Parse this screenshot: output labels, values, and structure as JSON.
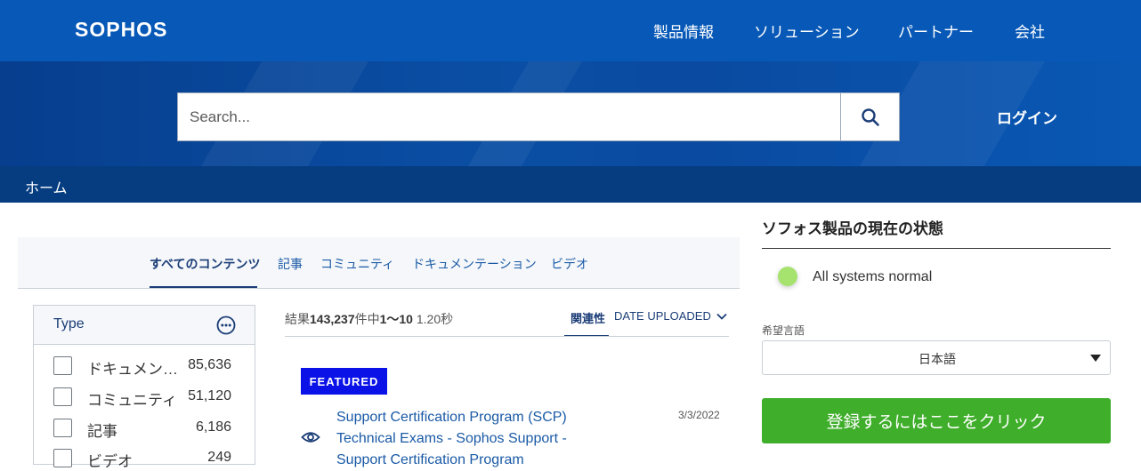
{
  "header": {
    "logo": "SOPHOS",
    "nav": [
      "製品情報",
      "ソリューション",
      "パートナー",
      "会社"
    ],
    "login": "ログイン"
  },
  "search": {
    "placeholder": "Search...",
    "value": ""
  },
  "breadcrumb": {
    "home": "ホーム"
  },
  "content_tabs": [
    "すべてのコンテンツ",
    "記事",
    "コミュニティ",
    "ドキュメンテーション",
    "ビデオ"
  ],
  "facet": {
    "title": "Type",
    "items": [
      {
        "label": "ドキュメンテーション",
        "count": "85,636"
      },
      {
        "label": "コミュニティ",
        "count": "51,120"
      },
      {
        "label": "記事",
        "count": "6,186"
      },
      {
        "label": "ビデオ",
        "count": "249"
      }
    ]
  },
  "results": {
    "prefix": "結果",
    "total": "143,237",
    "mid": "件中",
    "range": "1～10",
    "time": "1.20秒",
    "sort_relevance": "関連性",
    "sort_date": "DATE UPLOADED",
    "featured_badge": "FEATURED",
    "first_title": "Support Certification Program (SCP) Technical Exams - Sophos Support - Support Certification Program",
    "first_date": "3/3/2022"
  },
  "status": {
    "title": "ソフォス製品の現在の状態",
    "text": "All systems normal",
    "dot_color": "#a6e36e"
  },
  "language": {
    "label": "希望言語",
    "value": "日本語"
  },
  "register_button": "登録するにはここをクリック"
}
